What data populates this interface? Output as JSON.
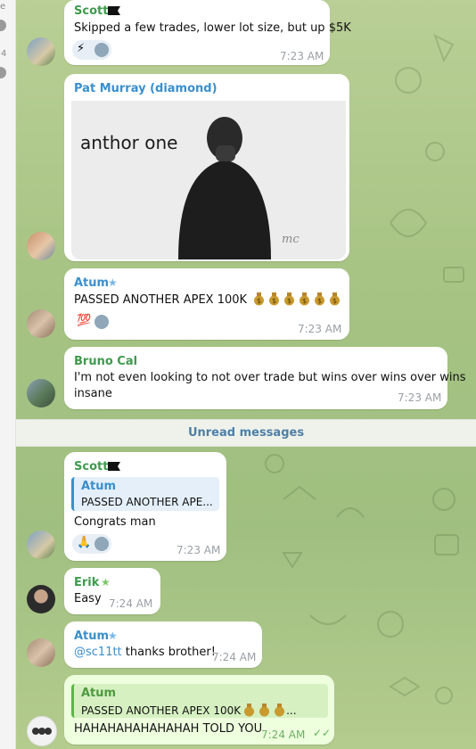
{
  "sidebar": {
    "fragment_1": "e",
    "fragment_2": "4"
  },
  "messages": [
    {
      "sender": "Scott",
      "text": "Skipped a few trades, lower lot size, but up $5K",
      "reaction": "⚡",
      "time": "7:23 AM"
    },
    {
      "sender": "Pat Murray (diamond)",
      "gif_caption": "anthor one",
      "gif_watermark": "mc"
    },
    {
      "sender": "Atum",
      "text": "PASSED ANOTHER APEX 100K",
      "reaction": "💯",
      "time": "7:23 AM"
    },
    {
      "sender": "Bruno Cal",
      "line1": "I'm not even looking to not over trade but wins over wins over wins",
      "line2": "insane",
      "time": "7:23 AM"
    },
    {
      "sender": "Scott",
      "quote_name": "Atum",
      "quote_text": "PASSED ANOTHER APE...",
      "text": "Congrats man",
      "reaction": "🙏",
      "time": "7:23 AM"
    },
    {
      "sender": "Erik",
      "text": "Easy",
      "time": "7:24 AM"
    },
    {
      "sender": "Atum",
      "mention": "@sc11tt",
      "text": " thanks brother!",
      "time": "7:24 AM"
    },
    {
      "quote_name": "Atum",
      "quote_text": "PASSED ANOTHER APEX 100K",
      "quote_tail": "...",
      "text": "HAHAHAHAHAHAHAH TOLD YOU",
      "time": "7:24 AM",
      "status": "✓✓"
    }
  ],
  "divider": {
    "label": "Unread messages"
  },
  "colors": {
    "sender_green": "#3e9b4d",
    "sender_blue": "#3a8fcc",
    "own_bubble": "#eeffde",
    "background": "#a6c383"
  },
  "icons": {
    "flag": "black-flag-icon",
    "star": "premium-star-icon",
    "bag": "money-bag-icon",
    "check": "double-check-icon"
  }
}
